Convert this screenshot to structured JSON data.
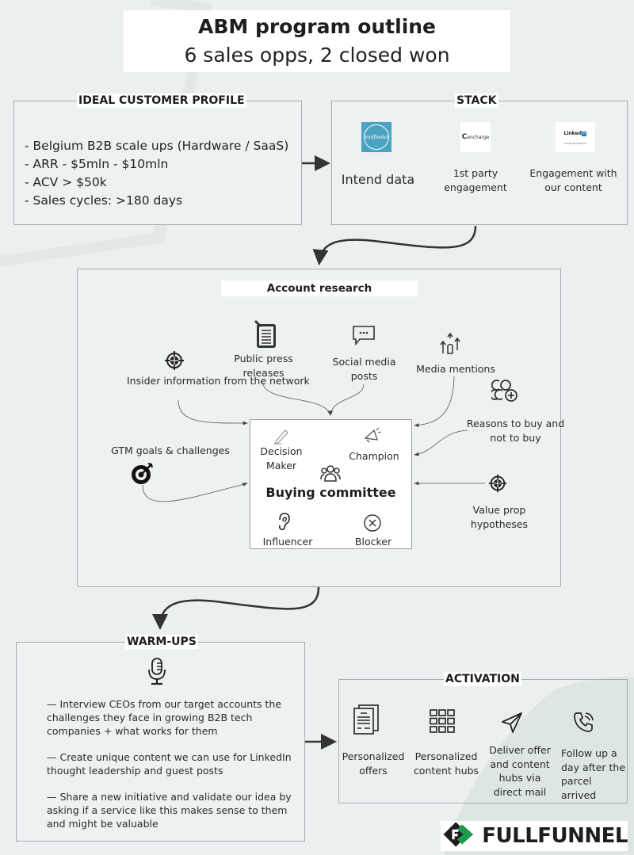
{
  "header": {
    "title": "ABM program outline",
    "subtitle": "6 sales opps, 2 closed won"
  },
  "icp": {
    "title": "IDEAL CUSTOMER PROFILE",
    "items": [
      "- Belgium B2B scale ups (Hardware / SaaS)",
      "- ARR - $5mln - $10mln",
      "- ACV > $50k",
      "- Sales cycles: >180 days"
    ]
  },
  "stack": {
    "title": "STACK",
    "tools": [
      {
        "logo": "leadfeeder",
        "label": "Intend data"
      },
      {
        "logo": "encharge",
        "label": "1st party engagement"
      },
      {
        "logo": "LinkedIn Sales Navigator",
        "label": "Engagement with our content"
      }
    ]
  },
  "research": {
    "title": "Account research",
    "sources": [
      {
        "icon": "target-icon",
        "label": "Insider information from the network"
      },
      {
        "icon": "document-icon",
        "label": "Public press releases"
      },
      {
        "icon": "chat-bubble-icon",
        "label": "Social media posts"
      },
      {
        "icon": "upvote-hand-icon",
        "label": "Media mentions"
      },
      {
        "icon": "coins-plus-icon",
        "label": "Reasons to buy and not to buy"
      },
      {
        "icon": "bullseye-icon",
        "label": "GTM goals & challenges"
      },
      {
        "icon": "crosshair-icon",
        "label": "Value prop hypotheses"
      }
    ],
    "committee": {
      "title": "Buying committee",
      "roles": [
        "Decision Maker",
        "Champion",
        "Influencer",
        "Blocker"
      ]
    }
  },
  "warmups": {
    "title": "WARM-UPS",
    "items": [
      "— Interview CEOs from our target accounts the challenges they face in growing B2B tech companies + what works for them",
      "— Create unique content we can use for LinkedIn thought leadership and guest posts",
      "— Share a new initiative and validate our idea by asking if a service like this makes sense to them and might be valuable"
    ]
  },
  "activation": {
    "title": "ACTIVATION",
    "steps": [
      {
        "icon": "documents-icon",
        "label": "Personalized offers"
      },
      {
        "icon": "grid-icon",
        "label": "Personalized content hubs"
      },
      {
        "icon": "send-icon",
        "label": "Deliver offer and content hubs via direct mail"
      },
      {
        "icon": "phone-icon",
        "label": "Follow up a day after the parcel arrived"
      }
    ]
  },
  "brand": {
    "name": "FULLFUNNEL",
    "colors": {
      "green": "#1f9a4a",
      "dark": "#1d1d1d"
    }
  },
  "logos": {
    "leadfeeder": "leadfeeder",
    "encharge": "encharge",
    "linkedin_word": "Linked",
    "linkedin_in": "in",
    "linkedin_sub": "SALES NAVIGATOR"
  }
}
